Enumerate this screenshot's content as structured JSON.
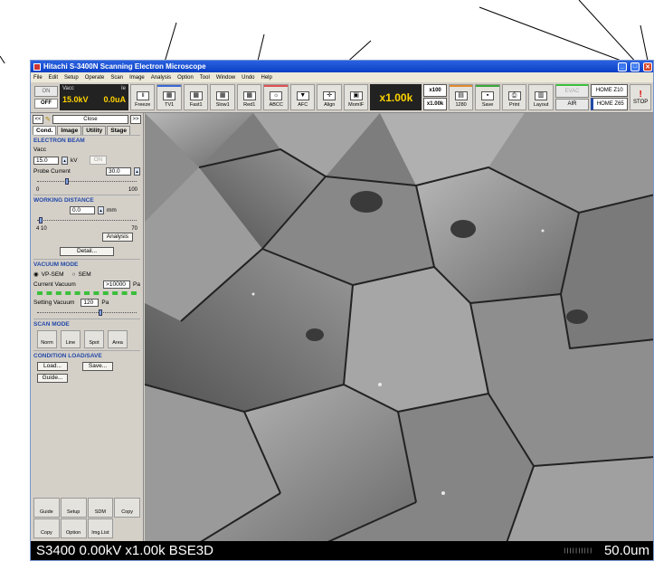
{
  "titlebar": {
    "title": "Hitachi S-3400N Scanning Electron Microscope"
  },
  "menu": [
    "File",
    "Edit",
    "Setup",
    "Operate",
    "Scan",
    "Image",
    "Analysis",
    "Option",
    "Tool",
    "Window",
    "Undo",
    "Help"
  ],
  "hv": {
    "on": "ON",
    "off": "OFF",
    "vacc_label": "Vacc",
    "ie_label": "Ie",
    "vacc": "15.0kV",
    "ie": "0.0uA"
  },
  "toolbar": {
    "freeze": "Freeze",
    "tv1": "TV1",
    "fast1": "Fast1",
    "slow1": "Slow1",
    "red1": "Red1",
    "abcc": "ABCC",
    "afc": "AFC",
    "align": "Align",
    "momif": "MomIF",
    "mag": "x1.00k",
    "mag_btn1": "x100",
    "mag_btn2": "x1.00k",
    "res": "1280",
    "save": "Save",
    "print": "Print",
    "layout": "Layout",
    "evac": "EVAC",
    "air": "AIR",
    "home_z10": "HOME Z10",
    "home_z65": "HOME Z65",
    "stop": "STOP"
  },
  "panel": {
    "nav_left": "<<",
    "close": "Close",
    "nav_right": ">>",
    "tabs": [
      "Cond.",
      "Image",
      "Utility",
      "Stage"
    ],
    "electron_beam": "ELECTRON BEAM",
    "vacc_label": "Vacc",
    "vacc_value": "15.0",
    "kv": "kV",
    "on_btn": "ON",
    "probe_label": "Probe Current",
    "probe_value": "30.0",
    "probe_min": "0",
    "probe_max": "100",
    "wd_title": "WORKING DISTANCE",
    "wd_value": "0.0",
    "mm": "mm",
    "wd_min": "4",
    "wd_mid": "10",
    "wd_max": "70",
    "analysis": "Analysis",
    "detail": "Detail...",
    "vac_mode": "VACUUM MODE",
    "vp_sem": "VP-SEM",
    "sem": "SEM",
    "current_vac": "Current Vacuum",
    "current_vac_value": ">10000",
    "pa": "Pa",
    "setting_vac": "Setting Vacuum",
    "setting_vac_value": "120",
    "scan_mode": "SCAN MODE",
    "norm": "Norm",
    "line": "Line",
    "spot": "Spot",
    "area": "Area",
    "cond_ls": "CONDITION LOAD/SAVE",
    "load": "Load...",
    "save": "Save...",
    "guide": "Guide...",
    "tools": [
      "Guide",
      "Setup",
      "SDM",
      "Copy",
      "Copy",
      "Option",
      "Img.List"
    ]
  },
  "statusbar": {
    "left": "S3400 0.00kV x1.00k BSE3D",
    "right": "50.0um"
  }
}
